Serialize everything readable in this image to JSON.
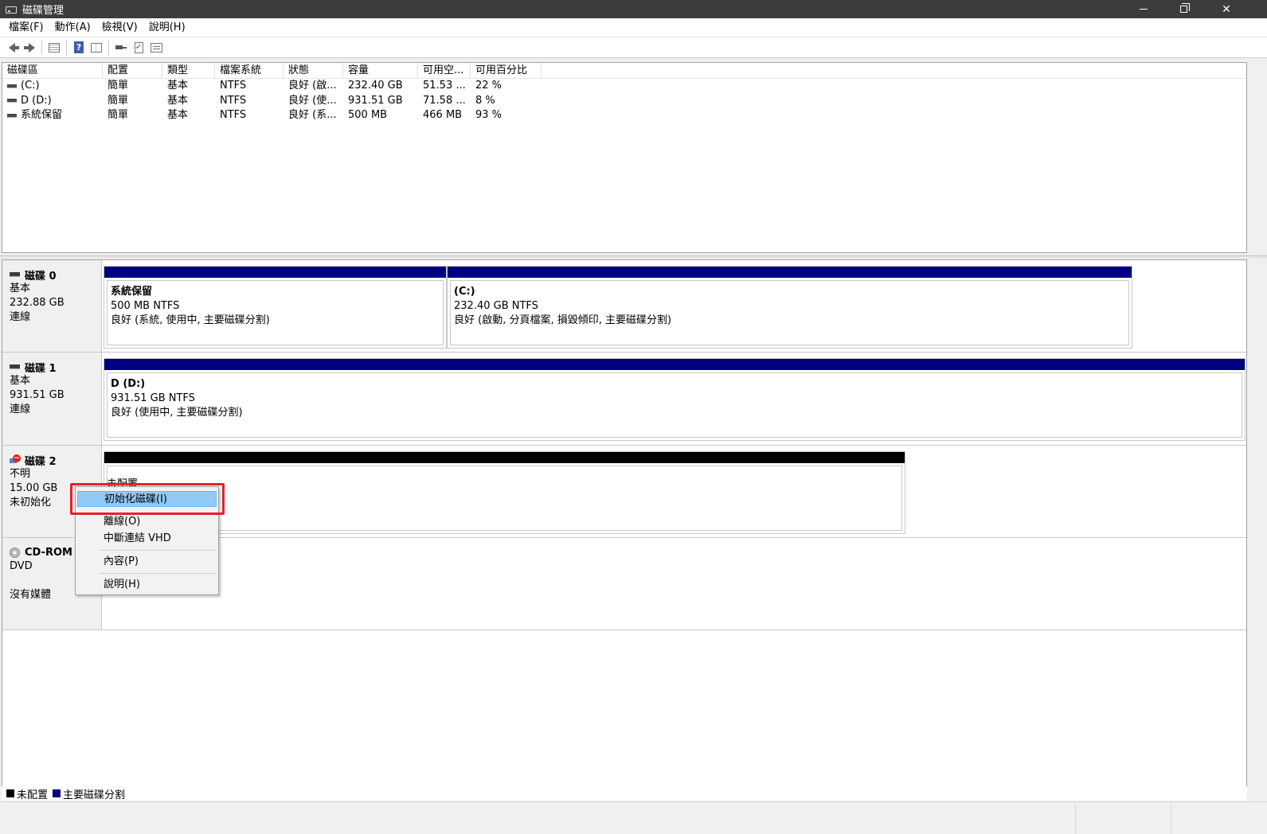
{
  "window": {
    "title": "磁碟管理"
  },
  "menu": [
    "檔案(F)",
    "動作(A)",
    "檢視(V)",
    "說明(H)"
  ],
  "volume_table": {
    "columns": [
      "磁碟區",
      "配置",
      "類型",
      "檔案系統",
      "狀態",
      "容量",
      "可用空...",
      "可用百分比"
    ],
    "rows": [
      [
        "(C:)",
        "簡單",
        "基本",
        "NTFS",
        "良好 (啟...",
        "232.40 GB",
        "51.53 ...",
        "22 %"
      ],
      [
        "D (D:)",
        "簡單",
        "基本",
        "NTFS",
        "良好 (使...",
        "931.51 GB",
        "71.58 ...",
        "8 %"
      ],
      [
        "系統保留",
        "簡單",
        "基本",
        "NTFS",
        "良好 (系...",
        "500 MB",
        "466 MB",
        "93 %"
      ]
    ]
  },
  "disks": [
    {
      "name": "磁碟 0",
      "type": "基本",
      "size": "232.88 GB",
      "status": "連線",
      "partitions": [
        {
          "title": "系統保留",
          "fs": "500 MB NTFS",
          "state": "良好 (系統, 使用中, 主要磁碟分割)"
        },
        {
          "title": "(C:)",
          "fs": "232.40 GB NTFS",
          "state": "良好 (啟動, 分頁檔案, 損毀傾印, 主要磁碟分割)"
        }
      ]
    },
    {
      "name": "磁碟 1",
      "type": "基本",
      "size": "931.51 GB",
      "status": "連線",
      "partitions": [
        {
          "title": "D  (D:)",
          "fs": "931.51 GB NTFS",
          "state": "良好 (使用中, 主要磁碟分割)"
        }
      ]
    },
    {
      "name": "磁碟 2",
      "type": "不明",
      "size": "15.00 GB",
      "status": "未初始化",
      "partitions": [
        {
          "title": "未配置"
        }
      ]
    },
    {
      "name": "CD-ROM",
      "type": "DVD",
      "size": "",
      "status": "沒有媒體",
      "partitions": []
    }
  ],
  "context_menu": {
    "items": [
      "初始化磁碟(I)",
      "離線(O)",
      "中斷連結 VHD",
      "內容(P)",
      "說明(H)"
    ],
    "highlighted": "初始化磁碟(I)"
  },
  "legend": [
    {
      "label": "未配置",
      "color": "#000000"
    },
    {
      "label": "主要磁碟分割",
      "color": "#000080"
    }
  ],
  "colors": {
    "primary_partition": "#000080",
    "unallocated": "#000000",
    "highlight_frame": "#e8202a",
    "menu_highlight": "#91c9f7"
  },
  "icons": [
    "back-arrow-icon",
    "forward-arrow-icon",
    "console-tree-icon",
    "help-icon",
    "list-view-icon",
    "connect-icon",
    "check-icon",
    "properties-icon"
  ]
}
